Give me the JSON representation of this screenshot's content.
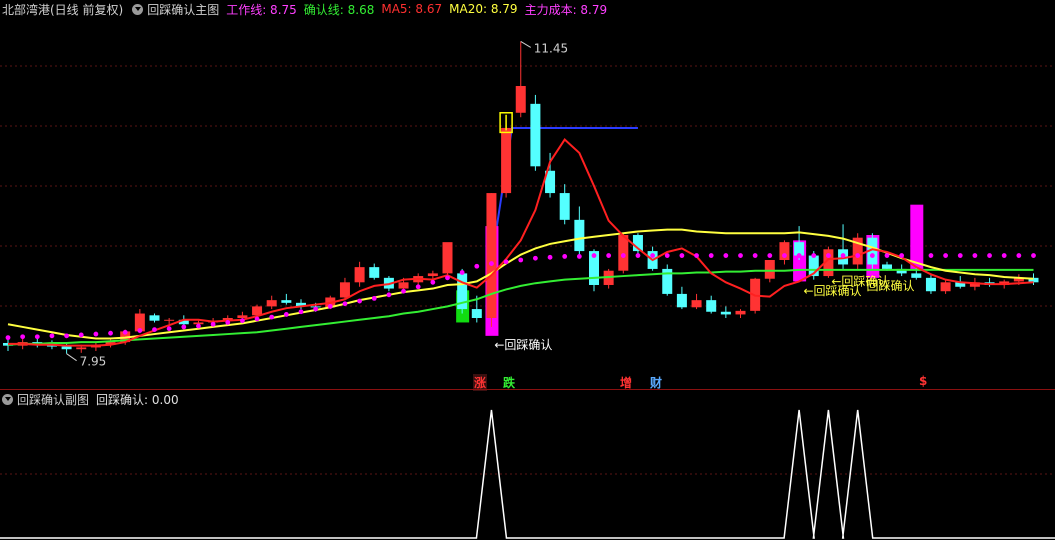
{
  "main_header": {
    "stock": "北部湾港(日线 前复权)",
    "indicator": "回踩确认主图",
    "work_line": "工作线: 8.75",
    "confirm_line": "确认线: 8.68",
    "ma5": "MA5: 8.67",
    "ma20": "MA20: 8.79",
    "main_cost": "主力成本: 8.79"
  },
  "sub_header": {
    "indicator": "回踩确认副图",
    "value": "回踩确认: 0.00"
  },
  "labels": {
    "high": "11.45",
    "low": "7.95",
    "callout1": "←回踩确认",
    "callout2": "←回踩确认",
    "callout3": "←回踩确认",
    "callout4": "回踩确认",
    "mark_zhang": "涨",
    "mark_die": "跌",
    "mark_zeng": "增",
    "mark_cai": "财",
    "mark_dollar": "$"
  },
  "colors": {
    "up": "#ff3333",
    "down": "#54ffff",
    "ma5": "#ff2020",
    "ma20": "#ffff40",
    "green_line": "#33ee33",
    "magenta": "#ff00ff",
    "blue_line": "#2a3cff"
  },
  "chart_data": {
    "type": "candlestick",
    "price_range": [
      7.7,
      11.6
    ],
    "candles": [
      [
        8.07,
        8.12,
        7.98,
        8.04
      ],
      [
        8.04,
        8.12,
        8.0,
        8.08
      ],
      [
        8.08,
        8.12,
        8.02,
        8.05
      ],
      [
        8.05,
        8.1,
        8.0,
        8.03
      ],
      [
        8.03,
        8.08,
        7.95,
        8.0
      ],
      [
        8.0,
        8.05,
        7.96,
        8.02
      ],
      [
        8.02,
        8.08,
        7.98,
        8.05
      ],
      [
        8.05,
        8.12,
        8.02,
        8.08
      ],
      [
        8.08,
        8.22,
        8.05,
        8.2
      ],
      [
        8.2,
        8.45,
        8.18,
        8.4
      ],
      [
        8.38,
        8.4,
        8.3,
        8.32
      ],
      [
        8.32,
        8.35,
        8.28,
        8.33
      ],
      [
        8.33,
        8.38,
        8.26,
        8.28
      ],
      [
        8.28,
        8.32,
        8.22,
        8.3
      ],
      [
        8.3,
        8.35,
        8.26,
        8.32
      ],
      [
        8.32,
        8.38,
        8.28,
        8.35
      ],
      [
        8.35,
        8.42,
        8.3,
        8.38
      ],
      [
        8.38,
        8.5,
        8.35,
        8.48
      ],
      [
        8.48,
        8.6,
        8.45,
        8.55
      ],
      [
        8.55,
        8.62,
        8.5,
        8.52
      ],
      [
        8.52,
        8.56,
        8.45,
        8.48
      ],
      [
        8.48,
        8.52,
        8.42,
        8.47
      ],
      [
        8.47,
        8.6,
        8.45,
        8.58
      ],
      [
        8.58,
        8.8,
        8.55,
        8.75
      ],
      [
        8.75,
        8.98,
        8.7,
        8.92
      ],
      [
        8.92,
        8.96,
        8.78,
        8.8
      ],
      [
        8.8,
        8.82,
        8.65,
        8.68
      ],
      [
        8.68,
        8.8,
        8.66,
        8.75
      ],
      [
        8.75,
        8.85,
        8.7,
        8.82
      ],
      [
        8.82,
        8.88,
        8.76,
        8.85
      ],
      [
        8.85,
        9.05,
        8.82,
        9.2
      ],
      [
        8.85,
        8.9,
        8.4,
        8.45
      ],
      [
        8.45,
        8.6,
        8.3,
        8.35
      ],
      [
        8.35,
        9.75,
        8.25,
        9.75
      ],
      [
        9.75,
        10.5,
        9.7,
        10.48
      ],
      [
        10.65,
        11.45,
        10.6,
        10.95
      ],
      [
        10.75,
        10.85,
        10.0,
        10.05
      ],
      [
        10.0,
        10.2,
        9.7,
        9.75
      ],
      [
        9.75,
        9.85,
        9.4,
        9.45
      ],
      [
        9.45,
        9.6,
        9.05,
        9.1
      ],
      [
        9.1,
        9.12,
        8.65,
        8.72
      ],
      [
        8.72,
        8.9,
        8.68,
        8.88
      ],
      [
        8.88,
        9.3,
        8.85,
        9.28
      ],
      [
        9.28,
        9.3,
        9.05,
        9.1
      ],
      [
        9.1,
        9.15,
        8.88,
        8.9
      ],
      [
        8.9,
        8.95,
        8.6,
        8.62
      ],
      [
        8.62,
        8.7,
        8.45,
        8.47
      ],
      [
        8.47,
        8.62,
        8.45,
        8.55
      ],
      [
        8.55,
        8.6,
        8.4,
        8.42
      ],
      [
        8.42,
        8.48,
        8.35,
        8.39
      ],
      [
        8.39,
        8.45,
        8.35,
        8.43
      ],
      [
        8.43,
        8.8,
        8.4,
        8.79
      ],
      [
        8.79,
        9.0,
        8.75,
        9.0
      ],
      [
        9.0,
        9.22,
        8.95,
        9.2
      ],
      [
        9.2,
        9.38,
        9.0,
        9.05
      ],
      [
        9.05,
        9.1,
        8.78,
        8.82
      ],
      [
        8.82,
        9.15,
        8.8,
        9.12
      ],
      [
        9.12,
        9.4,
        8.9,
        8.95
      ],
      [
        8.95,
        9.3,
        8.9,
        9.25
      ],
      [
        9.25,
        9.3,
        8.9,
        8.95
      ],
      [
        8.95,
        8.98,
        8.88,
        8.9
      ],
      [
        8.9,
        8.95,
        8.82,
        8.85
      ],
      [
        8.85,
        8.92,
        8.78,
        8.8
      ],
      [
        8.8,
        8.85,
        8.62,
        8.65
      ],
      [
        8.65,
        8.78,
        8.62,
        8.75
      ],
      [
        8.75,
        8.82,
        8.68,
        8.7
      ],
      [
        8.7,
        8.8,
        8.66,
        8.75
      ],
      [
        8.75,
        8.8,
        8.7,
        8.72
      ],
      [
        8.72,
        8.78,
        8.68,
        8.76
      ],
      [
        8.76,
        8.84,
        8.72,
        8.8
      ],
      [
        8.8,
        8.85,
        8.72,
        8.75
      ]
    ],
    "magenta_bars": [
      [
        33,
        8.15,
        9.38
      ],
      [
        54,
        8.76,
        9.22
      ],
      [
        59,
        8.8,
        9.28
      ],
      [
        62,
        8.9,
        9.62
      ]
    ],
    "green_bars": [
      [
        31,
        8.3,
        8.66
      ]
    ],
    "outline_bar": [
      34,
      10.43,
      10.65
    ],
    "blue_segments": [
      [
        [
          32.9,
          8.88
        ],
        [
          34.4,
          10.48
        ],
        [
          43,
          10.48
        ]
      ]
    ],
    "ma5": [
      8.06,
      8.06,
      8.05,
      8.05,
      8.04,
      8.04,
      8.04,
      8.05,
      8.08,
      8.15,
      8.21,
      8.27,
      8.33,
      8.33,
      8.31,
      8.32,
      8.33,
      8.37,
      8.42,
      8.46,
      8.48,
      8.5,
      8.52,
      8.56,
      8.65,
      8.71,
      8.73,
      8.78,
      8.79,
      8.78,
      8.83,
      8.75,
      8.69,
      8.83,
      9.01,
      9.22,
      9.56,
      10.1,
      10.35,
      10.2,
      9.83,
      9.44,
      9.27,
      9.13,
      9.0,
      9.09,
      9.13,
      9.04,
      8.85,
      8.75,
      8.68,
      8.6,
      8.59,
      8.71,
      8.76,
      8.85,
      9.01,
      9.02,
      9.05,
      9.12,
      9.09,
      9.03,
      8.92,
      8.84,
      8.78,
      8.75,
      8.74,
      8.73,
      8.73,
      8.74,
      8.75
    ],
    "ma20": [
      8.28,
      8.25,
      8.22,
      8.19,
      8.16,
      8.14,
      8.12,
      8.12,
      8.13,
      8.15,
      8.17,
      8.19,
      8.21,
      8.23,
      8.25,
      8.27,
      8.29,
      8.32,
      8.35,
      8.38,
      8.41,
      8.44,
      8.47,
      8.51,
      8.55,
      8.58,
      8.61,
      8.64,
      8.66,
      8.68,
      8.72,
      8.73,
      8.76,
      8.85,
      8.96,
      9.06,
      9.13,
      9.18,
      9.21,
      9.24,
      9.26,
      9.28,
      9.3,
      9.32,
      9.33,
      9.34,
      9.34,
      9.32,
      9.31,
      9.3,
      9.3,
      9.3,
      9.3,
      9.3,
      9.31,
      9.29,
      9.27,
      9.24,
      9.19,
      9.14,
      9.08,
      9.02,
      8.97,
      8.92,
      8.88,
      8.86,
      8.84,
      8.83,
      8.81,
      8.8,
      8.79
    ],
    "green_line": [
      8.05,
      8.06,
      8.06,
      8.07,
      8.07,
      8.08,
      8.08,
      8.09,
      8.1,
      8.11,
      8.12,
      8.13,
      8.14,
      8.15,
      8.16,
      8.17,
      8.18,
      8.19,
      8.21,
      8.23,
      8.25,
      8.27,
      8.29,
      8.31,
      8.33,
      8.35,
      8.37,
      8.4,
      8.42,
      8.45,
      8.48,
      8.52,
      8.56,
      8.62,
      8.67,
      8.71,
      8.74,
      8.76,
      8.78,
      8.79,
      8.8,
      8.81,
      8.82,
      8.83,
      8.84,
      8.85,
      8.85,
      8.86,
      8.86,
      8.87,
      8.87,
      8.88,
      8.88,
      8.88,
      8.89,
      8.89,
      8.89,
      8.89,
      8.89,
      8.89,
      8.89,
      8.89,
      8.89,
      8.89,
      8.89,
      8.89,
      8.89,
      8.89,
      8.89,
      8.89,
      8.89
    ],
    "dots": [
      8.13,
      8.14,
      8.14,
      8.15,
      8.15,
      8.16,
      8.17,
      8.18,
      8.19,
      8.21,
      8.22,
      8.23,
      8.25,
      8.26,
      8.28,
      8.3,
      8.32,
      8.34,
      8.36,
      8.39,
      8.42,
      8.45,
      8.48,
      8.51,
      8.54,
      8.57,
      8.61,
      8.65,
      8.7,
      8.75,
      8.8,
      8.86,
      8.93,
      8.96,
      8.98,
      9.0,
      9.02,
      9.03,
      9.04,
      9.04,
      9.05,
      9.05,
      9.05,
      9.05,
      9.05,
      9.05,
      9.05,
      9.05,
      9.05,
      9.05,
      9.05,
      9.05,
      9.05,
      9.05,
      9.05,
      9.05,
      9.05,
      9.05,
      9.05,
      9.05,
      9.05,
      9.05,
      9.05,
      9.05,
      9.05,
      9.05,
      9.05,
      9.05,
      9.05,
      9.05,
      9.05
    ],
    "sub_spikes": [
      33,
      54,
      56,
      58
    ]
  }
}
